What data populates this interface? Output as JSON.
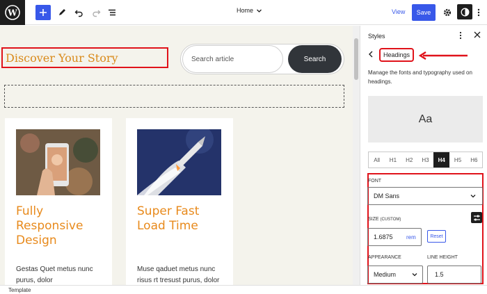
{
  "toolbar": {
    "document_title": "Home",
    "view_label": "View",
    "save_label": "Save"
  },
  "canvas": {
    "site_title": "Discover Your Story",
    "search": {
      "placeholder": "Search article",
      "button_label": "Search"
    },
    "cards": [
      {
        "title": "Fully Responsive Design",
        "excerpt": "Gestas Quet metus nunc purus, dolor"
      },
      {
        "title": "Super Fast Load Time",
        "excerpt": "Muse qaduet metus nunc risus rt tresust purus, dolor pretium"
      }
    ]
  },
  "footer": {
    "label": "Template"
  },
  "sidebar": {
    "title": "Styles",
    "nav_label": "Headings",
    "description": "Manage the fonts and typography used on headings.",
    "preview_text": "Aa",
    "levels": [
      "All",
      "H1",
      "H2",
      "H3",
      "H4",
      "H5",
      "H6"
    ],
    "active_level": "H4",
    "font": {
      "label": "FONT",
      "value": "DM Sans"
    },
    "size": {
      "label": "SIZE",
      "label_suffix": "(CUSTOM)",
      "value": "1.6875",
      "unit": "rem",
      "reset_label": "Reset"
    },
    "appearance": {
      "label": "APPEARANCE",
      "value": "Medium"
    },
    "line_height": {
      "label": "LINE HEIGHT",
      "value": "1.5"
    }
  },
  "colors": {
    "accent": "#3858e9",
    "highlight_red": "#e0121a",
    "card_title_orange": "#e88a1c"
  }
}
